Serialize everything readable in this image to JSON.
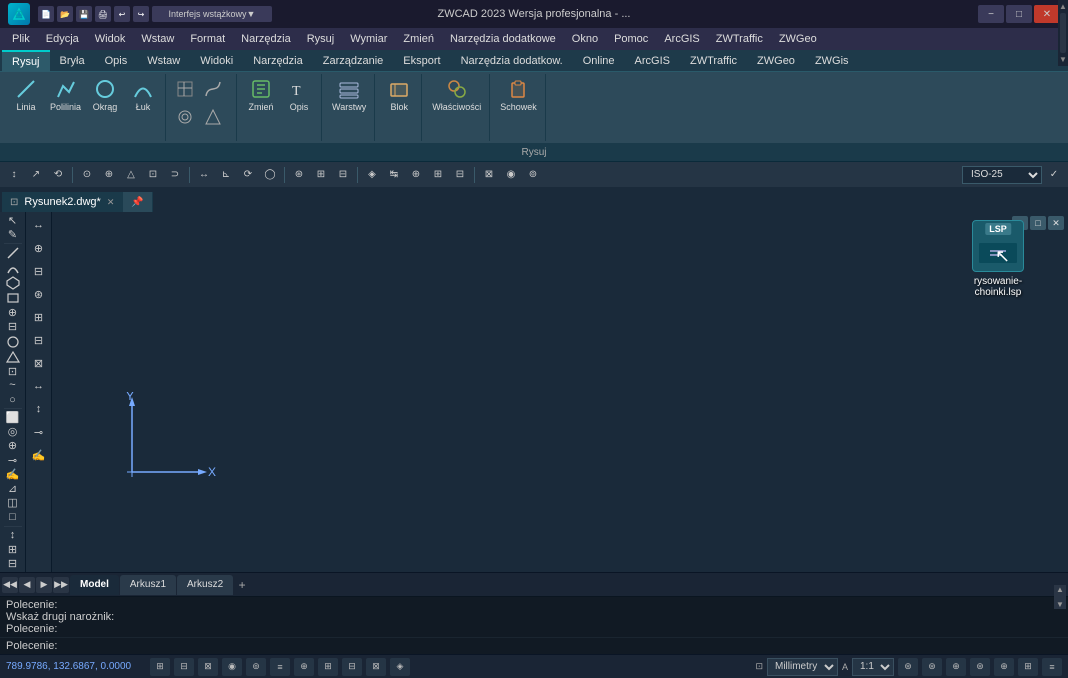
{
  "titleBar": {
    "appName": "ZWCAD",
    "title": "ZWCAD 2023 Wersja profesjonalna - ...",
    "interfaceDropdown": "Interfejs wstążkowy",
    "windowControls": {
      "minimize": "−",
      "restore": "□",
      "close": "✕"
    }
  },
  "menuBar": {
    "items": [
      "Plik",
      "Edycja",
      "Widok",
      "Wstaw",
      "Format",
      "Narzędzia",
      "Rysuj",
      "Wymiar",
      "Zmień",
      "Narzędzia dodatkowe",
      "Okno",
      "Pomoc",
      "ArcGIS",
      "ZWTraffic",
      "ZWGeo"
    ]
  },
  "ribbonTabs": {
    "items": [
      "Rysuj",
      "Bryła",
      "Opis",
      "Wstaw",
      "Widoki",
      "Narzędzia",
      "Zarządzanie",
      "Eksport",
      "Narzędzia dodatkow.",
      "Online",
      "ArcGIS",
      "ZWTraffic",
      "ZWGeo",
      "ZWGis"
    ],
    "active": "Rysuj"
  },
  "ribbon": {
    "label": "Rysuj",
    "buttons": [
      {
        "icon": "╱",
        "label": "Linia"
      },
      {
        "icon": "⌒",
        "label": "Polilinia"
      },
      {
        "icon": "○",
        "label": "Okrąg"
      },
      {
        "icon": "⌢",
        "label": "Łuk"
      },
      {
        "icon": "⊞",
        "label": ""
      },
      {
        "icon": "≋",
        "label": ""
      },
      {
        "icon": "✎",
        "label": "Zmień"
      },
      {
        "icon": "T",
        "label": "Opis"
      },
      {
        "icon": "◫",
        "label": "Warstwy"
      },
      {
        "icon": "⬛",
        "label": "Blok"
      },
      {
        "icon": "⚙",
        "label": "Właściwości"
      },
      {
        "icon": "📋",
        "label": "Schowek"
      }
    ]
  },
  "snapToolbar": {
    "dimStyle": "ISO-25",
    "buttons": [
      "↕",
      "↗",
      "⟲",
      "⚬",
      "⊕",
      "△",
      "⊡",
      "⊃",
      "↔",
      "⊾",
      "⟳",
      "◯",
      "⊛",
      "⊞",
      "⊟",
      "◈",
      "↹",
      "⊕",
      "⊞",
      "⊟",
      "⊠",
      "◉",
      "⊚"
    ]
  },
  "drawingTabs": {
    "tabs": [
      {
        "name": "Rysunek2.dwg*",
        "active": true
      },
      {
        "name": ""
      }
    ]
  },
  "drawingWindowControls": {
    "minimize": "−",
    "restore": "□",
    "close": "✕"
  },
  "leftToolbar": {
    "tools": [
      "↖",
      "✎",
      "╱",
      "⌒",
      "⬡",
      "⬠",
      "⊕",
      "⊟",
      "○",
      "△",
      "⊡",
      "~",
      "○",
      "⬜",
      "◎",
      "⊕",
      "⊸",
      "⌇",
      "⊿",
      "◫",
      "□",
      "↕",
      "⊞",
      "⊟",
      "⊠",
      "◉"
    ]
  },
  "leftToolbar2": {
    "tools": [
      "↔",
      "⊕",
      "⊟",
      "⊛",
      "⊞",
      "⊟",
      "⊠",
      "↔",
      "↕",
      "⊸",
      "⌇"
    ]
  },
  "sheetTabs": {
    "navButtons": [
      "◀◀",
      "◀",
      "▶",
      "▶▶"
    ],
    "tabs": [
      "Model",
      "Arkusz1",
      "Arkusz2"
    ],
    "active": "Model",
    "add": "+"
  },
  "commandArea": {
    "history": [
      "Polecenie:",
      "Wskaż drugi narożnik:",
      "Polecenie:"
    ],
    "prompt": "Polecenie:",
    "inputValue": ""
  },
  "statusBar": {
    "coords": "789.9786, 132.6867, 0.0000",
    "unit": "Millimetry",
    "scale": "1:1",
    "buttons": [
      "⊞",
      "⊟",
      "⊠",
      "◉",
      "⊚",
      "⊛",
      "⊕",
      "⊞",
      "⊟",
      "⊠",
      "◈"
    ]
  },
  "desktopIcon": {
    "badge": "LSP",
    "label": "rysowanie-choinki.lsp",
    "cursor": "↖"
  },
  "axes": {
    "xLabel": "X",
    "yLabel": "Y"
  }
}
